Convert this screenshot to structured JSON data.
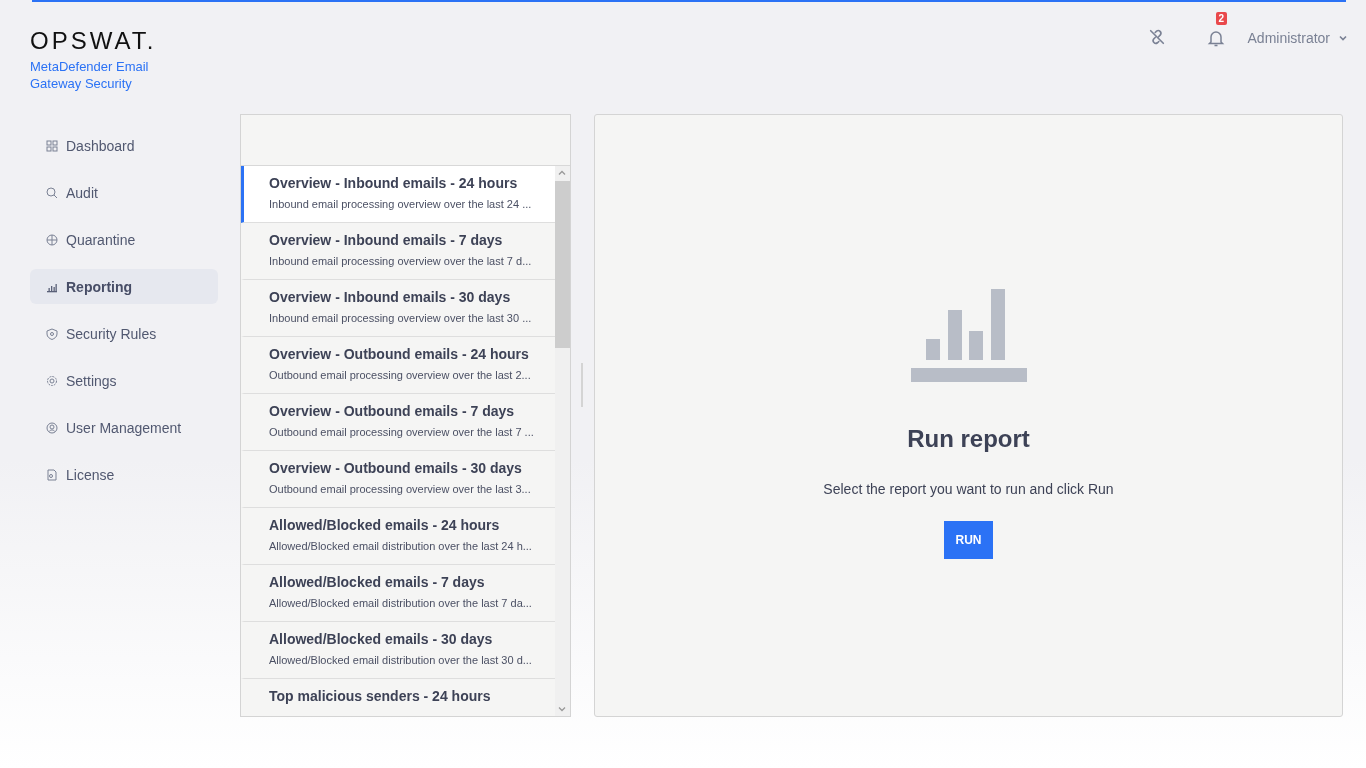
{
  "brand": {
    "logo": "OPSWAT.",
    "product": "MetaDefender Email Gateway Security"
  },
  "header": {
    "notifications": "2",
    "user": "Administrator"
  },
  "sidebar": {
    "items": [
      {
        "label": "Dashboard",
        "kind": "grid",
        "selected": false
      },
      {
        "label": "Audit",
        "kind": "audit",
        "selected": false
      },
      {
        "label": "Quarantine",
        "kind": "globe",
        "selected": false
      },
      {
        "label": "Reporting",
        "kind": "chart",
        "selected": true
      },
      {
        "label": "Security Rules",
        "kind": "shield",
        "selected": false
      },
      {
        "label": "Settings",
        "kind": "gear",
        "selected": false
      },
      {
        "label": "User Management",
        "kind": "user",
        "selected": false
      },
      {
        "label": "License",
        "kind": "license",
        "selected": false
      }
    ]
  },
  "reports": [
    {
      "title": "Overview - Inbound emails - 24 hours",
      "description": "Inbound email processing overview over the last 24 ...",
      "selected": true
    },
    {
      "title": "Overview - Inbound emails - 7 days",
      "description": "Inbound email processing overview over the last 7 d...",
      "selected": false
    },
    {
      "title": "Overview - Inbound emails - 30 days",
      "description": "Inbound email processing overview over the last 30 ...",
      "selected": false
    },
    {
      "title": "Overview - Outbound emails - 24 hours",
      "description": "Outbound email processing overview over the last 2...",
      "selected": false
    },
    {
      "title": "Overview - Outbound emails - 7 days",
      "description": "Outbound email processing overview over the last 7 ...",
      "selected": false
    },
    {
      "title": "Overview - Outbound emails - 30 days",
      "description": "Outbound email processing overview over the last 3...",
      "selected": false
    },
    {
      "title": "Allowed/Blocked emails - 24 hours",
      "description": "Allowed/Blocked email distribution over the last 24 h...",
      "selected": false
    },
    {
      "title": "Allowed/Blocked emails - 7 days",
      "description": "Allowed/Blocked email distribution over the last 7 da...",
      "selected": false
    },
    {
      "title": "Allowed/Blocked emails - 30 days",
      "description": "Allowed/Blocked email distribution over the last 30 d...",
      "selected": false
    },
    {
      "title": "Top malicious senders - 24 hours",
      "selected": false
    }
  ],
  "run_panel": {
    "title": "Run report",
    "message": "Select the report you want to run and click Run",
    "button": "RUN"
  }
}
